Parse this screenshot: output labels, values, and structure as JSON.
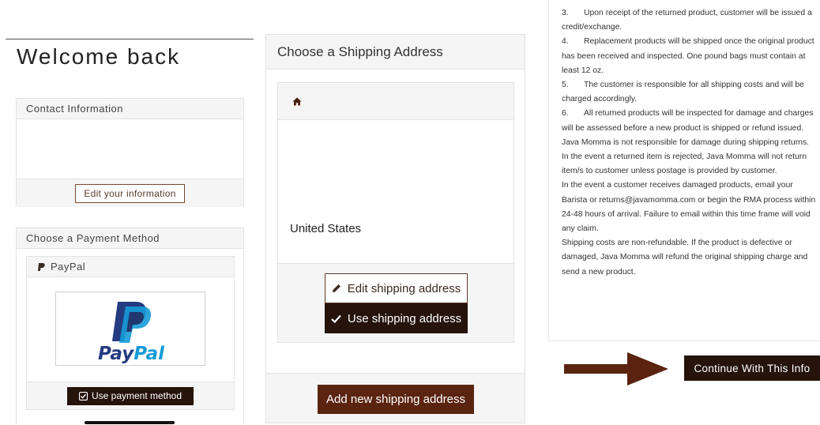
{
  "welcome_title": "Welcome back",
  "contact": {
    "heading": "Contact Information",
    "edit_button": "Edit your information"
  },
  "payment": {
    "heading": "Choose a Payment Method",
    "method_label": "PayPal",
    "logo_text_pay": "Pay",
    "logo_text_pal": "Pal",
    "use_button": "Use payment method"
  },
  "shipping": {
    "heading": "Choose a Shipping Address",
    "country": "United States",
    "edit_button": "Edit shipping address",
    "use_button": "Use shipping address",
    "add_button": "Add new shipping address"
  },
  "terms": {
    "items": [
      {
        "num": "3.",
        "text": "Upon receipt of the returned product, customer will be issued a credit/exchange."
      },
      {
        "num": "4.",
        "text": "Replacement products will be shipped once the original product has been received and inspected. One pound bags must contain at least 12 oz."
      },
      {
        "num": "5.",
        "text": "The customer is responsible for all shipping costs and will be charged accordingly."
      },
      {
        "num": "6.",
        "text": "All returned products will be inspected for damage and charges will be assessed before a new product is shipped or refund issued."
      }
    ],
    "paragraphs": [
      "Java Momma is not responsible for damage during shipping returns. In the event a returned item is rejected, Java Momma will not return item/s to customer unless postage is provided by customer.",
      "In the event a customer receives damaged products, email your Barista or returns@javamomma.com or begin the RMA process within 24-48 hours of arrival. Failure to email within this time frame will void any claim.",
      "Shipping costs are non-refundable. If the product is defective or damaged, Java Momma will refund the original shipping charge and send a new product."
    ]
  },
  "continue_button": "Continue With This Info",
  "colors": {
    "dark_brown": "#25130c",
    "button_brown": "#5a2410",
    "arrow_brown": "#5a2410",
    "paypal_dark_blue": "#253b80",
    "paypal_light_blue": "#179bd7"
  }
}
